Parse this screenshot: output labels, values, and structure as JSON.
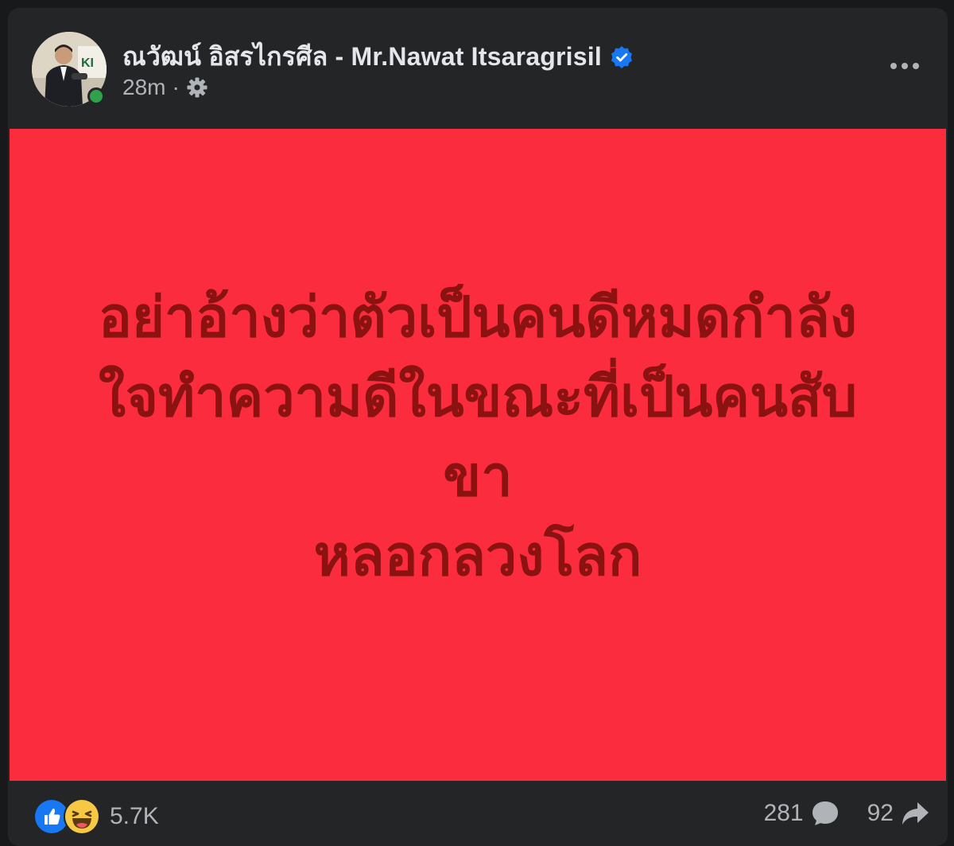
{
  "post": {
    "author_name": "ณวัฒน์ อิสรไกรศีล - Mr.Nawat Itsaragrisil",
    "verified": true,
    "time": "28m",
    "separator": "·",
    "audience_icon": "gear-icon",
    "more_icon": "more-options-icon"
  },
  "image": {
    "background_color": "#fb2c3d",
    "text_color": "#8a1210",
    "text": "อย่าอ้างว่าตัวเป็นคนดีหมดกำลัง\nใจทำความดีในขณะที่เป็นคนสับ\nขา\nหลอกลวงโลก"
  },
  "footer": {
    "reaction_icons": [
      "like-icon",
      "haha-icon"
    ],
    "reactions_count": "5.7K",
    "comments_count": "281",
    "shares_count": "92"
  },
  "colors": {
    "card_background": "#242526",
    "primary_text": "#e4e6eb",
    "secondary_text": "#b0b3b8",
    "verified_blue": "#1877f2",
    "online_green": "#31a24c"
  }
}
